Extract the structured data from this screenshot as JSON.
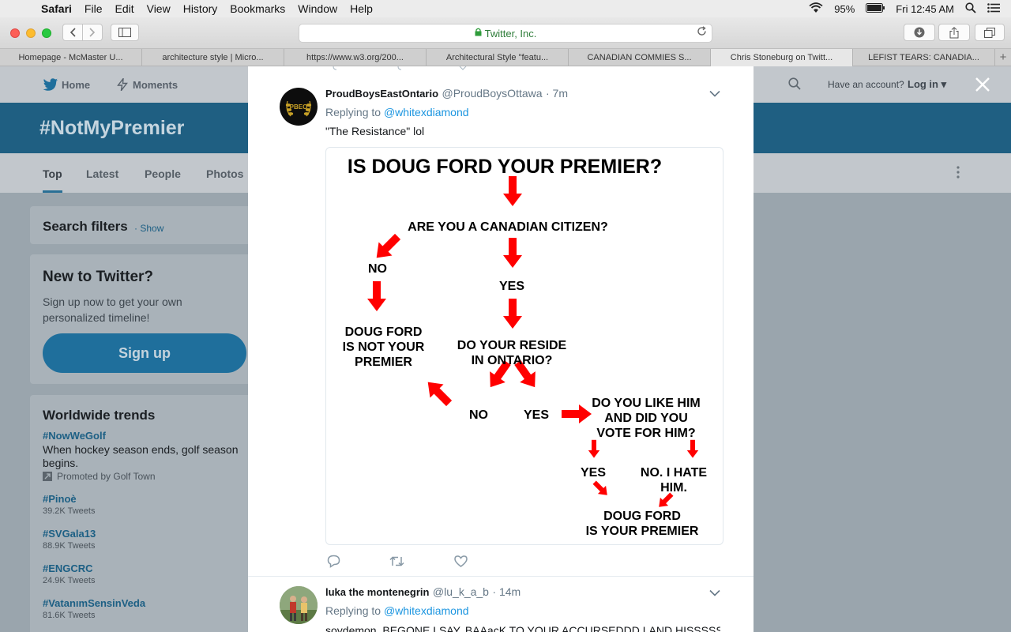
{
  "menubar": {
    "app": "Safari",
    "items": [
      "File",
      "Edit",
      "View",
      "History",
      "Bookmarks",
      "Window",
      "Help"
    ],
    "battery": "95%",
    "clock": "Fri 12:45 AM"
  },
  "browser": {
    "url_display": "Twitter, Inc.",
    "tabs": [
      "Homepage - McMaster U...",
      "architecture style | Micro...",
      "https://www.w3.org/200...",
      "Architectural Style \"featu...",
      "CANADIAN COMMIES S...",
      "Chris Stoneburg on Twitt...",
      "LEFIST TEARS: CANADIA..."
    ],
    "active_tab_index": 5
  },
  "twitter": {
    "nav": {
      "home": "Home",
      "moments": "Moments",
      "have_account": "Have an account?",
      "login": "Log in"
    },
    "hashtag": "#NotMyPremier",
    "filter_tabs": [
      "Top",
      "Latest",
      "People",
      "Photos"
    ],
    "search_filters": {
      "title": "Search filters",
      "show": "Show"
    },
    "signup": {
      "title": "New to Twitter?",
      "text": "Sign up now to get your own personalized timeline!",
      "button": "Sign up"
    },
    "trends": {
      "title": "Worldwide trends",
      "promoted": {
        "name": "#NowWeGolf",
        "desc": "When hockey season ends, golf season begins.",
        "by": "Promoted by Golf Town"
      },
      "items": [
        {
          "name": "#Pinoè",
          "count": "39.2K Tweets"
        },
        {
          "name": "#SVGala13",
          "count": "88.9K Tweets"
        },
        {
          "name": "#ENGCRC",
          "count": "24.9K Tweets"
        },
        {
          "name": "#VatanımSensinVeda",
          "count": "81.6K Tweets"
        }
      ]
    }
  },
  "tweets": [
    {
      "name": "ProudBoysEastOntario",
      "handle": "@ProudBoysOttawa",
      "time": "7m",
      "replying_label": "Replying to",
      "replying_to": "@whitexdiamond",
      "text": "\"The Resistance\" lol",
      "avatar_text": "PBEO"
    },
    {
      "name": "luka the montenegrin",
      "handle": "@lu_k_a_b",
      "time": "14m",
      "replying_label": "Replying to",
      "replying_to": "@whitexdiamond",
      "text": "soydemon. BEGONE I SAY. BAAacK TO YOUR ACCURSEDDD LAND HISSSSS"
    }
  ],
  "flowchart": {
    "title": "IS DOUG FORD YOUR PREMIER?",
    "q1": "ARE YOU A CANADIAN CITIZEN?",
    "no1": "NO",
    "yes1": "YES",
    "not_premier": [
      "DOUG FORD",
      "IS NOT YOUR",
      "PREMIER"
    ],
    "q2": [
      "DO YOUR RESIDE",
      "IN ONTARIO?"
    ],
    "no2": "NO",
    "yes2": "YES",
    "q3": [
      "DO YOU LIKE HIM",
      "AND DID YOU",
      "VOTE FOR HIM?"
    ],
    "yes3": "YES",
    "no3": [
      "NO. I HATE",
      "HIM."
    ],
    "is_premier": [
      "DOUG FORD",
      "IS YOUR PREMIER"
    ],
    "arrow_color": "#ff0000"
  }
}
